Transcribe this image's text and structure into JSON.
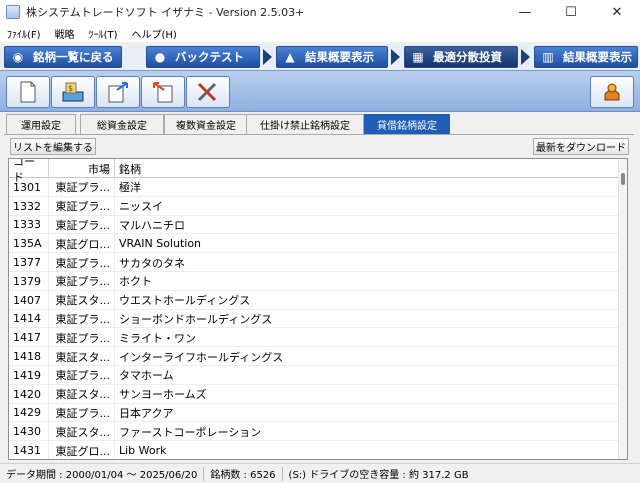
{
  "window": {
    "title": "株システムトレードソフト イザナミ - Version 2.5.03+",
    "minimize": "—",
    "maximize": "☐",
    "close": "✕"
  },
  "menu": [
    "ﾌｧｲﾙ(F)",
    "戦略",
    "ﾂｰﾙ(T)",
    "ヘルプ(H)"
  ],
  "nav": {
    "back_label": "銘柄一覧に戻る",
    "backtest_label": "バックテスト",
    "summary1_label": "結果概要表示",
    "optimal_label": "最適分散投資",
    "summary2_label": "結果概要表示"
  },
  "tabs": [
    "運用設定",
    "総資金設定",
    "複数資金設定",
    "仕掛け禁止銘柄設定",
    "貸借銘柄設定"
  ],
  "buttons": {
    "edit_list": "リストを編集する",
    "download_latest": "最新をダウンロード"
  },
  "table": {
    "columns": [
      "コード",
      "市場",
      "銘柄"
    ],
    "rows": [
      [
        "1301",
        "東証プラ...",
        "極洋"
      ],
      [
        "1332",
        "東証プラ...",
        "ニッスイ"
      ],
      [
        "1333",
        "東証プラ...",
        "マルハニチロ"
      ],
      [
        "135A",
        "東証グロ...",
        "VRAIN Solution"
      ],
      [
        "1377",
        "東証プラ...",
        "サカタのタネ"
      ],
      [
        "1379",
        "東証プラ...",
        "ホクト"
      ],
      [
        "1407",
        "東証スタ...",
        "ウエストホールディングス"
      ],
      [
        "1414",
        "東証プラ...",
        "ショーボンドホールディングス"
      ],
      [
        "1417",
        "東証プラ...",
        "ミライト・ワン"
      ],
      [
        "1418",
        "東証スタ...",
        "インターライフホールディングス"
      ],
      [
        "1419",
        "東証プラ...",
        "タマホーム"
      ],
      [
        "1420",
        "東証スタ...",
        "サンヨーホームズ"
      ],
      [
        "1429",
        "東証プラ...",
        "日本アクア"
      ],
      [
        "1430",
        "東証スタ...",
        "ファーストコーポレーション"
      ],
      [
        "1431",
        "東証グロ...",
        "Lib Work"
      ]
    ]
  },
  "status": {
    "period": "データ期間 : 2000/01/04 ～ 2025/06/20",
    "count": "銘柄数 : 6526",
    "disk": "(S:) ドライブの空き容量 : 約 317.2 GB"
  }
}
